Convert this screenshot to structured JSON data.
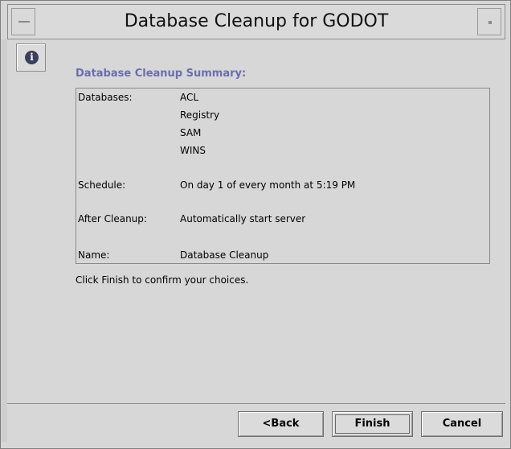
{
  "window": {
    "title": "Database Cleanup for GODOT"
  },
  "summary": {
    "heading": "Database Cleanup Summary:",
    "databases_label": "Databases:",
    "databases": [
      "ACL",
      "Registry",
      "SAM",
      "WINS"
    ],
    "schedule_label": "Schedule:",
    "schedule_value": "On day 1 of every month at 5:19 PM",
    "after_cleanup_label": "After Cleanup:",
    "after_cleanup_value": "Automatically start server",
    "name_label": "Name:",
    "name_value": "Database Cleanup"
  },
  "confirm_text": "Click Finish to confirm your choices.",
  "buttons": {
    "back": "<Back",
    "finish": "Finish",
    "cancel": "Cancel"
  },
  "icons": {
    "info": "info-icon",
    "window_menu": "window-menu-icon",
    "maximize": "maximize-icon"
  }
}
